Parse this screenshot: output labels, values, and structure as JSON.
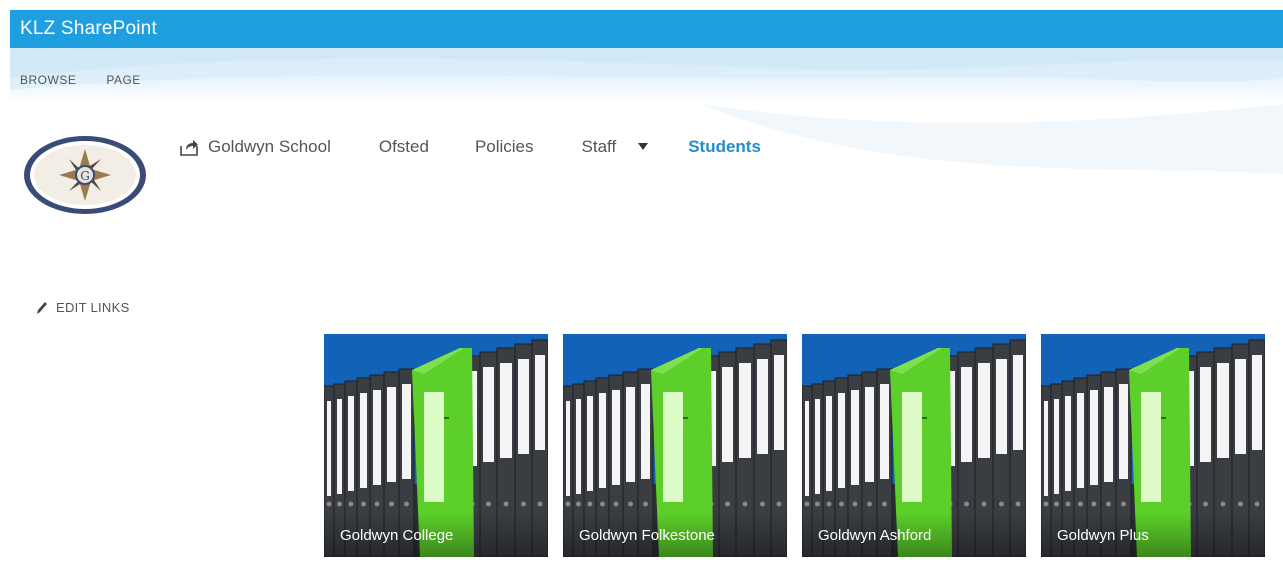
{
  "suite_bar": {
    "title": "KLZ SharePoint"
  },
  "ribbon": {
    "tabs": [
      {
        "label": "BROWSE"
      },
      {
        "label": "PAGE"
      }
    ]
  },
  "top_nav": {
    "items": [
      {
        "label": "Goldwyn School",
        "icon": "share-icon"
      },
      {
        "label": "Ofsted"
      },
      {
        "label": "Policies"
      },
      {
        "label": "Staff",
        "icon": "chevron-down-icon"
      },
      {
        "label": "Students",
        "selected": true
      }
    ]
  },
  "edit_links": {
    "label": "EDIT LINKS",
    "icon": "pencil-icon"
  },
  "tiles": [
    {
      "label": "Goldwyn College"
    },
    {
      "label": "Goldwyn Folkestone"
    },
    {
      "label": "Goldwyn Ashford"
    },
    {
      "label": "Goldwyn Plus"
    }
  ],
  "colors": {
    "suite_bar": "#1f9fe0",
    "selected_nav": "#1f8fd0",
    "tile_sky": "#1262b8",
    "binder_green": "#5ccf2a"
  }
}
